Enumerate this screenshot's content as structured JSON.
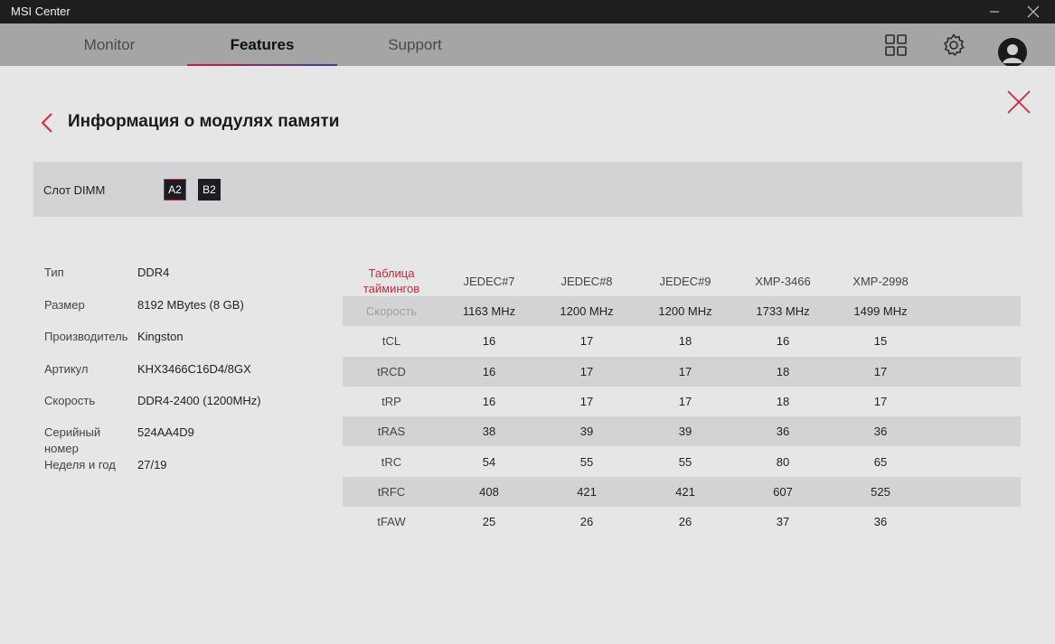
{
  "window": {
    "title": "MSI Center"
  },
  "nav": {
    "tabs": [
      {
        "label": "Monitor"
      },
      {
        "label": "Features"
      },
      {
        "label": "Support"
      }
    ],
    "active_tab": "Features"
  },
  "page": {
    "title": "Информация о модулях памяти"
  },
  "dimm": {
    "label": "Слот DIMM",
    "slots": [
      "A2",
      "B2"
    ],
    "selected": "A2"
  },
  "info": [
    {
      "key": "Тип",
      "value": "DDR4"
    },
    {
      "key": "Размер",
      "value": "8192 MBytes (8 GB)"
    },
    {
      "key": "Производитель",
      "value": "Kingston"
    },
    {
      "key": "Артикул",
      "value": "KHX3466C16D4/8GX"
    },
    {
      "key": "Скорость",
      "value": "DDR4-2400 (1200MHz)"
    },
    {
      "key": "Серийный номер",
      "value": "524AA4D9"
    },
    {
      "key": "Неделя и год",
      "value": "27/19"
    }
  ],
  "timings": {
    "header_label": "Таблица таймингов",
    "columns": [
      "JEDEC#7",
      "JEDEC#8",
      "JEDEC#9",
      "XMP-3466",
      "XMP-2998"
    ],
    "rows": [
      {
        "label": "Скорость",
        "values": [
          "1163 MHz",
          "1200 MHz",
          "1200 MHz",
          "1733 MHz",
          "1499 MHz"
        ]
      },
      {
        "label": "tCL",
        "values": [
          "16",
          "17",
          "18",
          "16",
          "15"
        ]
      },
      {
        "label": "tRCD",
        "values": [
          "16",
          "17",
          "17",
          "18",
          "17"
        ]
      },
      {
        "label": "tRP",
        "values": [
          "16",
          "17",
          "17",
          "18",
          "17"
        ]
      },
      {
        "label": "tRAS",
        "values": [
          "38",
          "39",
          "39",
          "36",
          "36"
        ]
      },
      {
        "label": "tRC",
        "values": [
          "54",
          "55",
          "55",
          "80",
          "65"
        ]
      },
      {
        "label": "tRFC",
        "values": [
          "408",
          "421",
          "421",
          "607",
          "525"
        ]
      },
      {
        "label": "tFAW",
        "values": [
          "25",
          "26",
          "26",
          "37",
          "36"
        ]
      }
    ]
  },
  "colors": {
    "accent": "#c82a3c",
    "titlebar": "#1e1e1e",
    "navbar": "#a5a5a5",
    "background": "#e6e6e6",
    "row_shade": "#d3d3d6"
  },
  "icons": [
    "minimize-icon",
    "close-icon",
    "grid-icon",
    "gear-icon",
    "avatar",
    "close-x-icon",
    "back-chevron-icon"
  ]
}
